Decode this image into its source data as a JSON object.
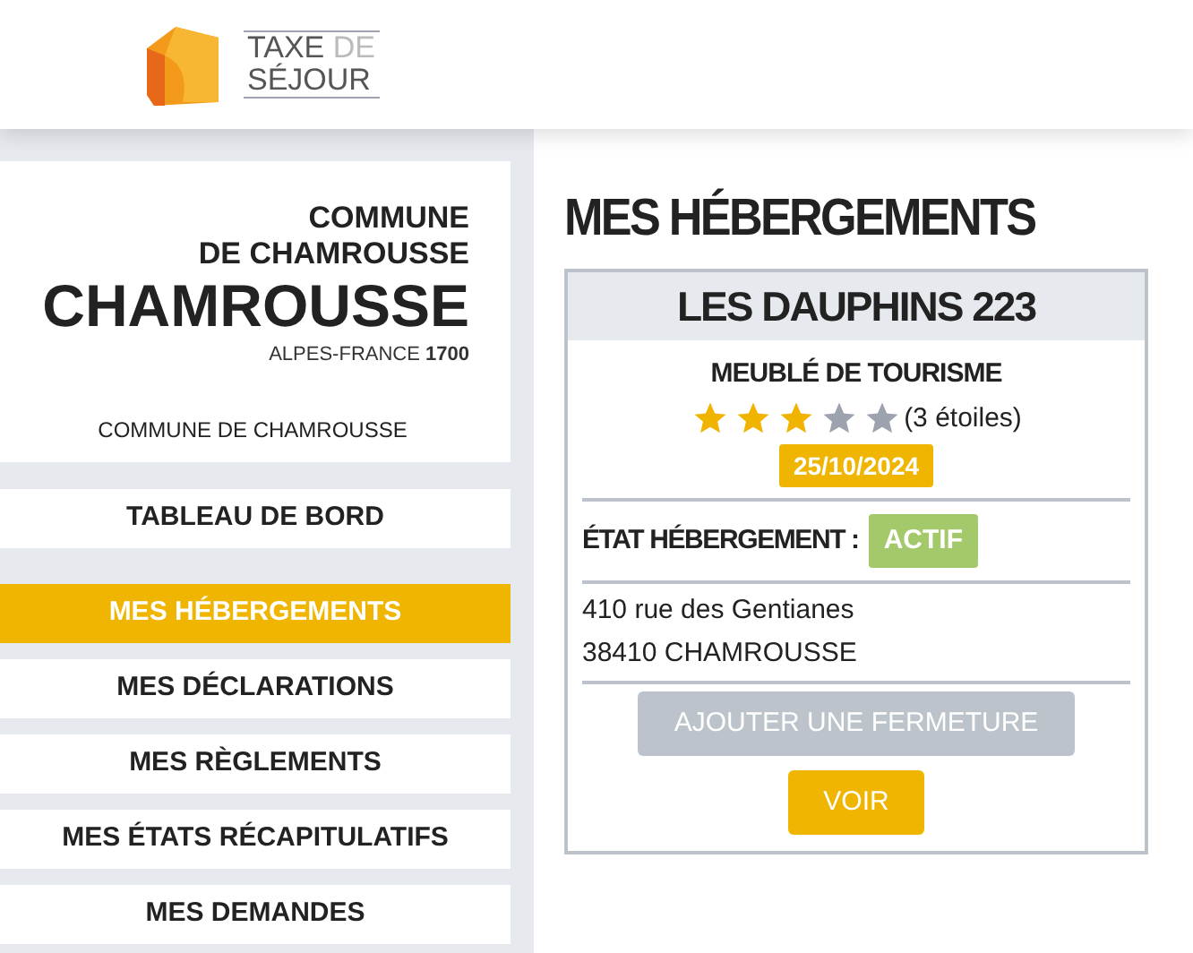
{
  "header": {
    "logo": {
      "word_1": "TAXE",
      "word_2": "DE",
      "word_3": "SÉJOUR"
    }
  },
  "sidebar": {
    "commune_logo": {
      "line_1": "COMMUNE",
      "line_2": "DE CHAMROUSSE",
      "wordmark": "CHAMROUSSE",
      "tagline": "ALPES-FRANCE **1700**"
    },
    "commune_name": "COMMUNE DE CHAMROUSSE",
    "items": [
      {
        "label": "TABLEAU DE BORD",
        "selected": false
      },
      {
        "label": "MES HÉBERGEMENTS",
        "selected": true
      },
      {
        "label": "MES DÉCLARATIONS",
        "selected": false
      },
      {
        "label": "MES RÈGLEMENTS",
        "selected": false
      },
      {
        "label": "MES ÉTATS RÉCAPITULATIFS",
        "selected": false
      },
      {
        "label": "MES DEMANDES",
        "selected": false
      }
    ]
  },
  "page_title": "MES HÉBERGEMENTS",
  "accommodations": [
    {
      "name": "LES DAUPHINS 223",
      "type": "MEUBLÉ DE TOURISME",
      "stars": 3,
      "stars_text": "(3 étoiles)",
      "date": "25/10/2024",
      "state_label": "ÉTAT HÉBERGEMENT :",
      "state": "ACTIF",
      "address": [
        "410 rue des Gentianes",
        "38410 CHAMROUSSE"
      ],
      "buttons": [
        {
          "label": "AJOUTER UNE FERMETURE",
          "disabled": true
        },
        {
          "label": "VOIR",
          "disabled": false
        }
      ]
    }
  ]
}
